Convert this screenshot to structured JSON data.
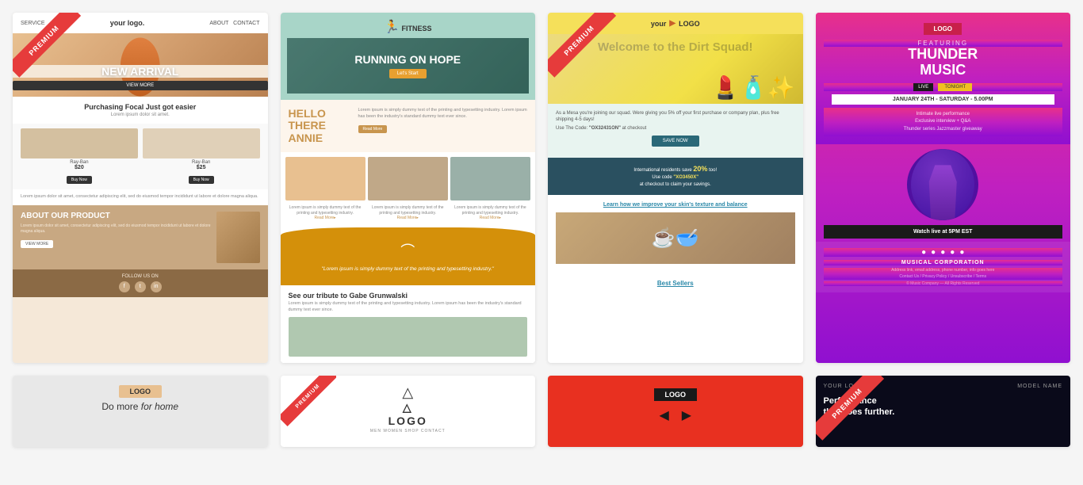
{
  "cards": [
    {
      "id": "card1",
      "type": "fashion",
      "premium": true,
      "nav": {
        "service": "SERVICE",
        "logo": "your logo.",
        "about": "ABOUT",
        "contact": "CONTACT"
      },
      "hero": {
        "title": "NEW ARRIVAL",
        "button": "VIEW MORE"
      },
      "section": {
        "title": "Purchasing Focal Just got easier",
        "subtitle": "Lorem ipsum dolor sit amet."
      },
      "products": [
        {
          "name": "Ray-Ban",
          "price": "$20",
          "button": "Buy Now"
        },
        {
          "name": "Ray-Ban",
          "price": "$25",
          "button": "Buy Now"
        }
      ],
      "body_text": "Lorem ipsum dolor sit amet, consectetur adipiscing elit, sed do eiusmod tempor incididunt ut labore et dolore magna aliqua.",
      "about": {
        "title": "ABOUT OUR PRODUCT",
        "body": "Lorem ipsum dolor sit amet, consectetur adipiscing elit, sed do eiusmod tempor incididunt ut labore et dolore magna aliqua.",
        "button": "VIEW MORE"
      },
      "footer": {
        "follow": "FOLLOW US ON",
        "social": [
          "f",
          "t",
          "in"
        ]
      }
    },
    {
      "id": "card2",
      "type": "fitness",
      "premium": false,
      "logo": "FITNESS",
      "hero": {
        "title": "RUNNING ON HOPE",
        "button": "Let's Start"
      },
      "intro": {
        "greeting": "HELLO THERE ANNIE",
        "body": "Lorem ipsum is simply dummy text of the printing and typesetting industry. Lorem ipsum has been the industry's standard dummy text ever since.",
        "button": "Read More"
      },
      "gallery": [
        {
          "caption": "Lorem ipsum is simply dummy text of the printing and typesetting industry.",
          "read_more": "Read More▸"
        },
        {
          "caption": "Lorem ipsum is simply dummy text of the printing and typesetting industry.",
          "read_more": "Read More▸"
        },
        {
          "caption": "Lorem ipsum is simply dummy text of the printing and typesetting industry.",
          "read_more": "Read More▸"
        }
      ],
      "wave": {
        "quote": "\"Lorem ipsum is simply dummy text of the printing and typesetting industry.\""
      },
      "tribute": {
        "title": "See our tribute to Gabe Grunwalski",
        "body": "Lorem ipsum is simply dummy text of the printing and typesetting industry. Lorem ipsum has been the industry's standard dummy text ever since."
      }
    },
    {
      "id": "card3",
      "type": "beauty",
      "premium": true,
      "logo": "your LOGO",
      "hero": {
        "title": "Welcome to the Dirt Squad!"
      },
      "promo": {
        "body": "As a Mesa you're joining our squad. Were giving you 5% off your first purchase or company plan, plus free shipping 4-5 days!",
        "code_label": "Use The Code:",
        "code": "\"OX32431ON\"",
        "code_suffix": "at checkout",
        "button": "SAVE NOW"
      },
      "intl": {
        "text": "International residents save",
        "highlight": "20%",
        "text2": "too!",
        "code_label": "Use code",
        "code": "\"XO3450X\"",
        "text3": "at checkout to claim your savings."
      },
      "skin": {
        "link": "Learn how we improve your skin's texture and balance"
      },
      "best_sellers": {
        "label": "Best Sellers"
      }
    },
    {
      "id": "card4",
      "type": "music",
      "premium": false,
      "logo": "LOGO",
      "featuring": "FEATURING",
      "title_line1": "THUNDER",
      "title_line2": "MUSIC",
      "badges": {
        "live": "LIVE",
        "tonight": "TONIGHT"
      },
      "date_bar": "JANUARY 24TH - SATURDAY - 5.00PM",
      "details": [
        "Intimate live performance",
        "Exclusive interview + Q&A",
        "Thunder series Jazzmaster giveaway"
      ],
      "watch_btn": "Watch live at 5PM EST",
      "social": [
        "f",
        "t",
        "in",
        "ig",
        "yt"
      ],
      "corp_name": "MUSICAL CORPORATION",
      "footer_links": "Address link, email address, phone number, info goes here\nContact Us / Privacy Policy / Unsubscribe / Terms",
      "copyright": "© Music Company — All Rights Reserved"
    }
  ],
  "row2": [
    {
      "id": "partial1",
      "type": "home",
      "logo": "LOGO",
      "tagline_plain": "Do more ",
      "tagline_italic": "for home"
    },
    {
      "id": "partial2",
      "type": "fitness2",
      "premium": true,
      "logo": "△\nLOGO",
      "nav": "MEN  WOMEN  SHOP  CONTACT"
    },
    {
      "id": "partial3",
      "type": "red",
      "logo": "LOGO"
    },
    {
      "id": "partial4",
      "type": "tech",
      "premium": true,
      "logo": "YOUR LOGO",
      "model": "MODEL NAME",
      "title": "Performance\nthat goes further."
    }
  ]
}
